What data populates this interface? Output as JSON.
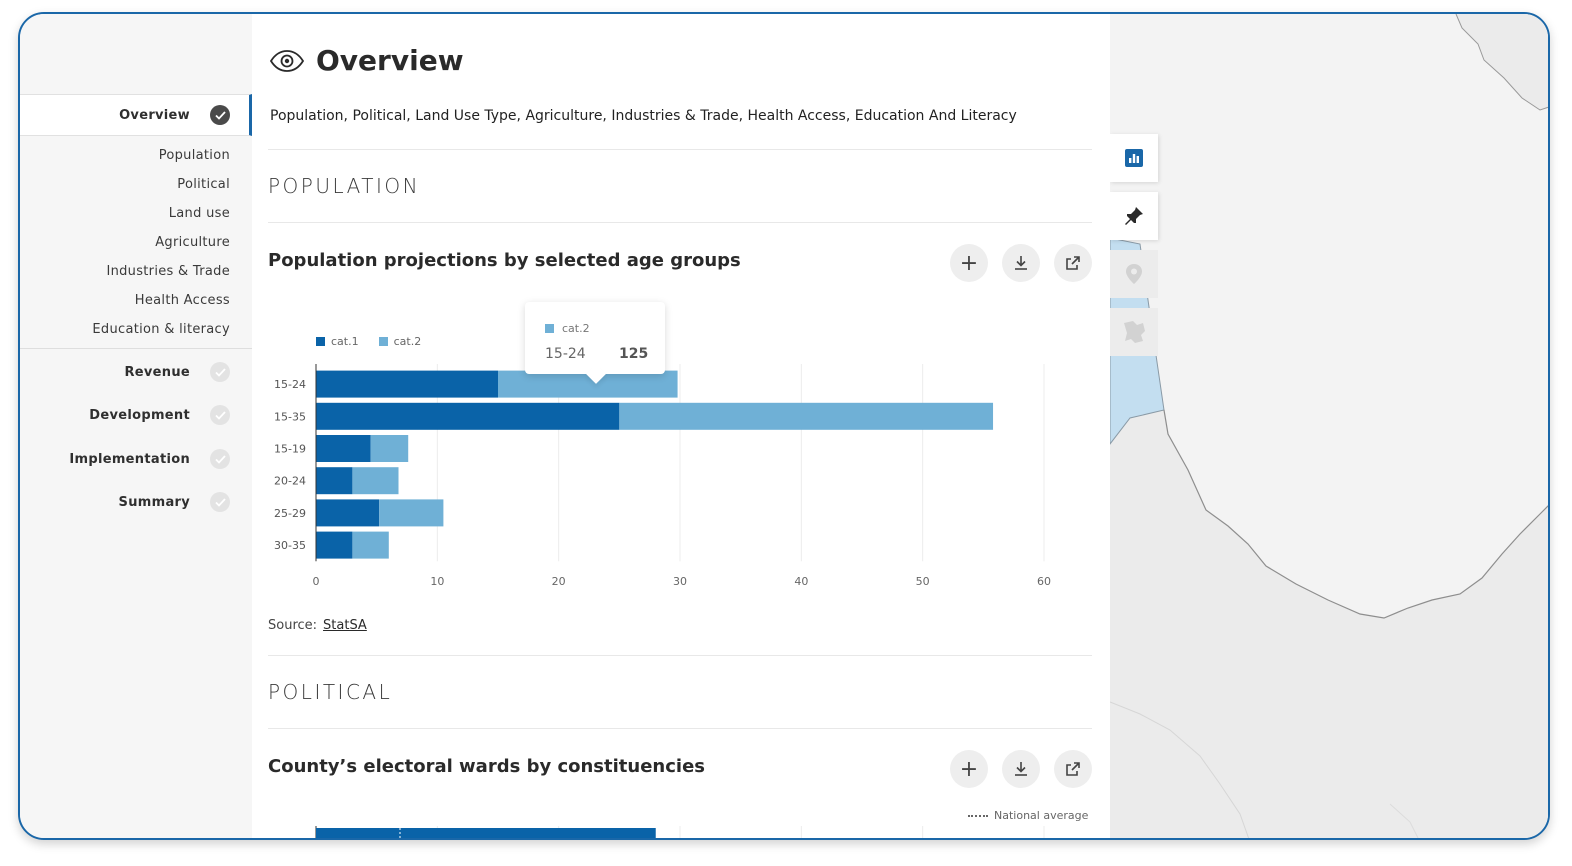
{
  "sidebar": {
    "active_item": "Overview",
    "sub_items": [
      "Population",
      "Political",
      "Land use",
      "Agriculture",
      "Industries & Trade",
      "Health Access",
      "Education & literacy"
    ],
    "main_items": [
      "Revenue",
      "Development",
      "Implementation",
      "Summary"
    ]
  },
  "page": {
    "title": "Overview",
    "breadcrumb": "Population, Political, Land Use Type, Agriculture, Industries & Trade, Health Access, Education And Literacy"
  },
  "sections": {
    "population": {
      "label": "POPULATION",
      "chart_title": "Population projections by selected age groups",
      "source_label": "Source:",
      "source_link": "StatSA"
    },
    "political": {
      "label": "POLITICAL",
      "chart_title": "County’s electoral wards by constituencies",
      "legend_national_average": "National average"
    }
  },
  "actions": {
    "add": "+",
    "download": "download-icon",
    "open": "external-link-icon"
  },
  "tooltip": {
    "series": "cat.2",
    "category": "15-24",
    "value": "125"
  },
  "colors": {
    "cat1": "#0a63a8",
    "cat2": "#6fb0d6",
    "accent": "#1a67a8"
  },
  "chart_data": {
    "type": "bar",
    "orientation": "horizontal",
    "stacked": true,
    "categories": [
      "15-24",
      "15-35",
      "15-19",
      "20-24",
      "25-29",
      "30-35"
    ],
    "series": [
      {
        "name": "cat.1",
        "values": [
          15,
          25,
          4.5,
          3,
          5.2,
          3
        ]
      },
      {
        "name": "cat.2",
        "values": [
          14.8,
          30.8,
          3.1,
          3.8,
          5.3,
          3
        ]
      }
    ],
    "xlim": [
      0,
      60
    ],
    "xticks": [
      0,
      10,
      20,
      30,
      40,
      50,
      60
    ],
    "grid": true,
    "legend": "top-left"
  },
  "political_chart_data": {
    "type": "bar",
    "first_bar_value": 28
  }
}
